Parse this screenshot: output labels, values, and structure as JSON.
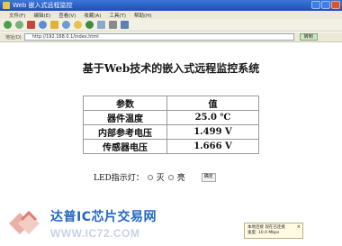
{
  "window": {
    "title": "Web 嵌入式远程监控"
  },
  "menu": {
    "items": [
      "文件(F)",
      "编辑(E)",
      "查看(V)",
      "收藏(A)",
      "工具(T)",
      "帮助(H)"
    ]
  },
  "address": {
    "label": "地址(D)",
    "url": "http://192.168.0.1/index.html",
    "go_label": "转到"
  },
  "page": {
    "title": "基于Web技术的嵌入式远程监控系统",
    "table": {
      "headers": [
        "参数",
        "值"
      ],
      "rows": [
        {
          "param": "器件温度",
          "value": "25.0 ℃"
        },
        {
          "param": "内部参考电压",
          "value": "1.499 V"
        },
        {
          "param": "传感器电压",
          "value": "1.666 V"
        }
      ]
    },
    "led": {
      "label": "LED指示灯：",
      "off_label": "灭",
      "on_label": "亮",
      "button_label": "确定"
    }
  },
  "watermark": {
    "cn": "达普IC芯片交易网",
    "url": "WWW.IC72.COM"
  },
  "notification": {
    "title": "本地连接 现在已连接",
    "text": "速度: 10.0 Mbps"
  }
}
